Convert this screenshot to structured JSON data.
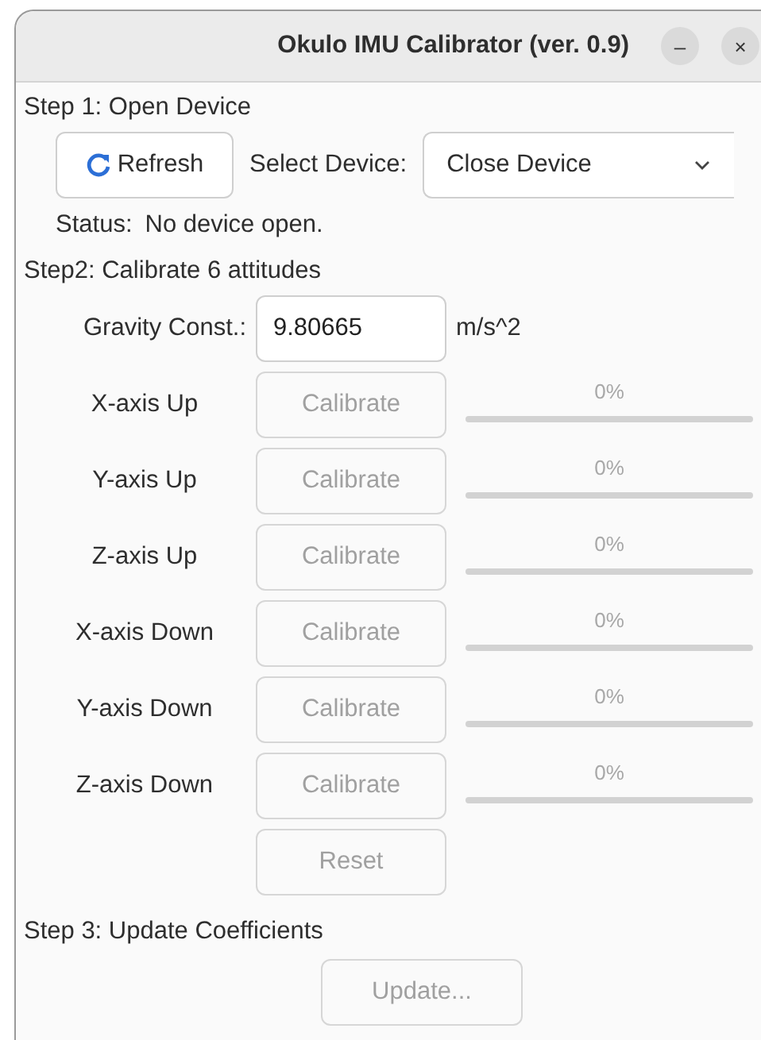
{
  "window": {
    "title": "Okulo IMU Calibrator (ver. 0.9)",
    "controls": [
      "–",
      "×"
    ]
  },
  "step1": {
    "heading": "Step 1: Open Device",
    "refresh": {
      "label": "Refresh",
      "disabled": false
    },
    "device_label": "Select Device:",
    "device_value": "Close Device",
    "status_label": "Status:",
    "status_value": "No device open."
  },
  "step2": {
    "heading": "Step2: Calibrate 6 attitudes",
    "gravity_label": "Gravity Const.:",
    "gravity_value": "9.80665",
    "gravity_unit": "m/s^2",
    "rows": [
      {
        "label": "X-axis Up",
        "button": "Calibrate",
        "disabled": true,
        "progress": "0%",
        "level": 0
      },
      {
        "label": "Y-axis Up",
        "button": "Calibrate",
        "disabled": true,
        "progress": "0%",
        "level": 0
      },
      {
        "label": "Z-axis Up",
        "button": "Calibrate",
        "disabled": true,
        "progress": "0%",
        "level": 0
      },
      {
        "label": "X-axis Down",
        "button": "Calibrate",
        "disabled": true,
        "progress": "0%",
        "level": 0
      },
      {
        "label": "Y-axis Down",
        "button": "Calibrate",
        "disabled": true,
        "progress": "0%",
        "level": 0
      },
      {
        "label": "Z-axis Down",
        "button": "Calibrate",
        "disabled": true,
        "progress": "0%",
        "level": 0
      }
    ],
    "reset": {
      "label": "Reset",
      "disabled": true
    }
  },
  "step3": {
    "heading": "Step 3: Update Coefficients",
    "update": {
      "label": "Update...",
      "disabled": true
    }
  }
}
